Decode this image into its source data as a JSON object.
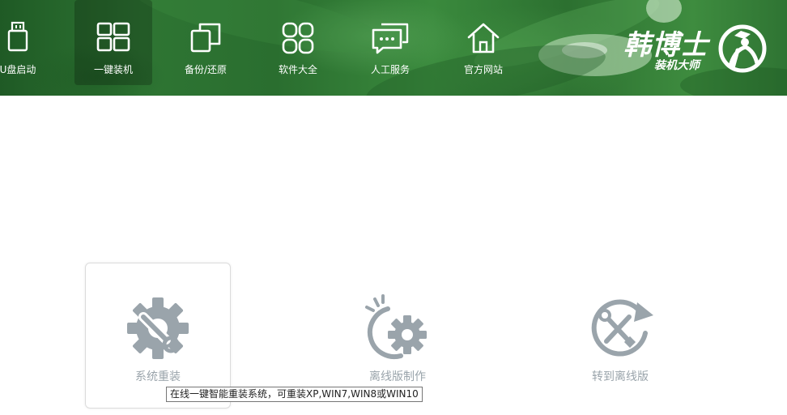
{
  "nav": {
    "items": [
      {
        "label": "U盘启动",
        "icon": "usb-drive-icon"
      },
      {
        "label": "一键装机",
        "icon": "windows-icon",
        "active": true
      },
      {
        "label": "备份/还原",
        "icon": "copy-icon"
      },
      {
        "label": "软件大全",
        "icon": "apps-grid-icon"
      },
      {
        "label": "人工服务",
        "icon": "chat-icon"
      },
      {
        "label": "官方网站",
        "icon": "home-icon"
      }
    ]
  },
  "brand": {
    "name": "韩博士",
    "subtitle": "装机大师"
  },
  "features": [
    {
      "label": "系统重装",
      "icon": "gear-wrench-icon"
    },
    {
      "label": "离线版制作",
      "icon": "offline-gear-icon"
    },
    {
      "label": "转到离线版",
      "icon": "tools-refresh-icon"
    }
  ],
  "tooltip": {
    "text": "在线一键智能重装系统，可重装XP,WIN7,WIN8或WIN10"
  },
  "colors": {
    "banner_green": "#2e7533",
    "icon_gray": "#9aa4ab",
    "label_gray": "#9aa4ab"
  }
}
